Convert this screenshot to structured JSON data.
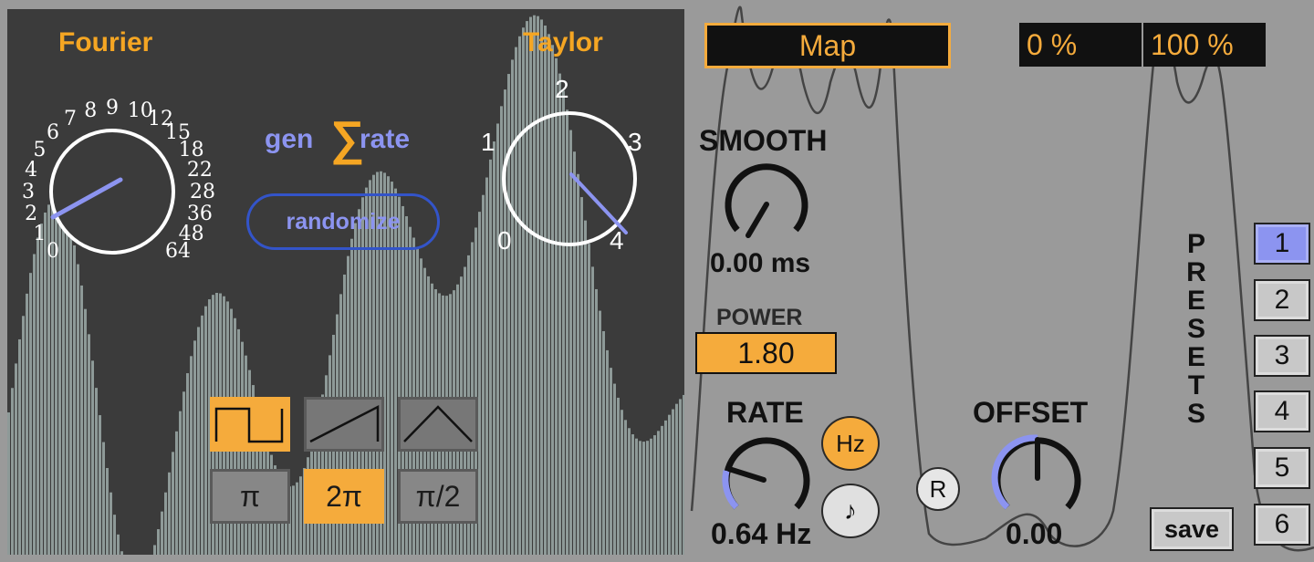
{
  "left": {
    "fourier_title": "Fourier",
    "taylor_title": "Taylor",
    "logo": {
      "part1": "gen",
      "sigma": "∑",
      "part2": "rate"
    },
    "randomize_label": "randomize",
    "fourier_dial": {
      "scale": [
        "0",
        "1",
        "2",
        "3",
        "4",
        "5",
        "6",
        "7",
        "8",
        "9",
        "10",
        "12",
        "15",
        "18",
        "22",
        "28",
        "36",
        "48",
        "64"
      ],
      "value": "2"
    },
    "taylor_dial": {
      "scale": [
        "0",
        "1",
        "2",
        "3",
        "4"
      ],
      "value": "4"
    },
    "waveforms": [
      {
        "name": "square",
        "active": true
      },
      {
        "name": "saw",
        "active": false
      },
      {
        "name": "triangle",
        "active": false
      }
    ],
    "periods": [
      {
        "label": "π",
        "active": false
      },
      {
        "label": "2π",
        "active": true
      },
      {
        "label": "π/2",
        "active": false
      }
    ]
  },
  "right": {
    "map_label": "Map",
    "range_min": "0 %",
    "range_max": "100 %",
    "smooth": {
      "label": "SMOOTH",
      "value": "0.00 ms"
    },
    "power": {
      "label": "POWER",
      "value": "1.80"
    },
    "rate": {
      "label": "RATE",
      "value": "0.64 Hz",
      "hz_label": "Hz",
      "note_label": "♪"
    },
    "offset": {
      "label": "OFFSET",
      "value": "0.00"
    },
    "reset_label": "R",
    "presets": {
      "letters": [
        "P",
        "R",
        "E",
        "S",
        "E",
        "T",
        "S"
      ],
      "buttons": [
        "1",
        "2",
        "3",
        "4",
        "5",
        "6"
      ],
      "active": "1",
      "save_label": "save"
    }
  },
  "colors": {
    "accent": "#f5ab3c",
    "lavender": "#8c94f0",
    "panel_dark": "#3b3b3b",
    "bars": "#8e9a98",
    "bg": "#9a9a9a"
  }
}
